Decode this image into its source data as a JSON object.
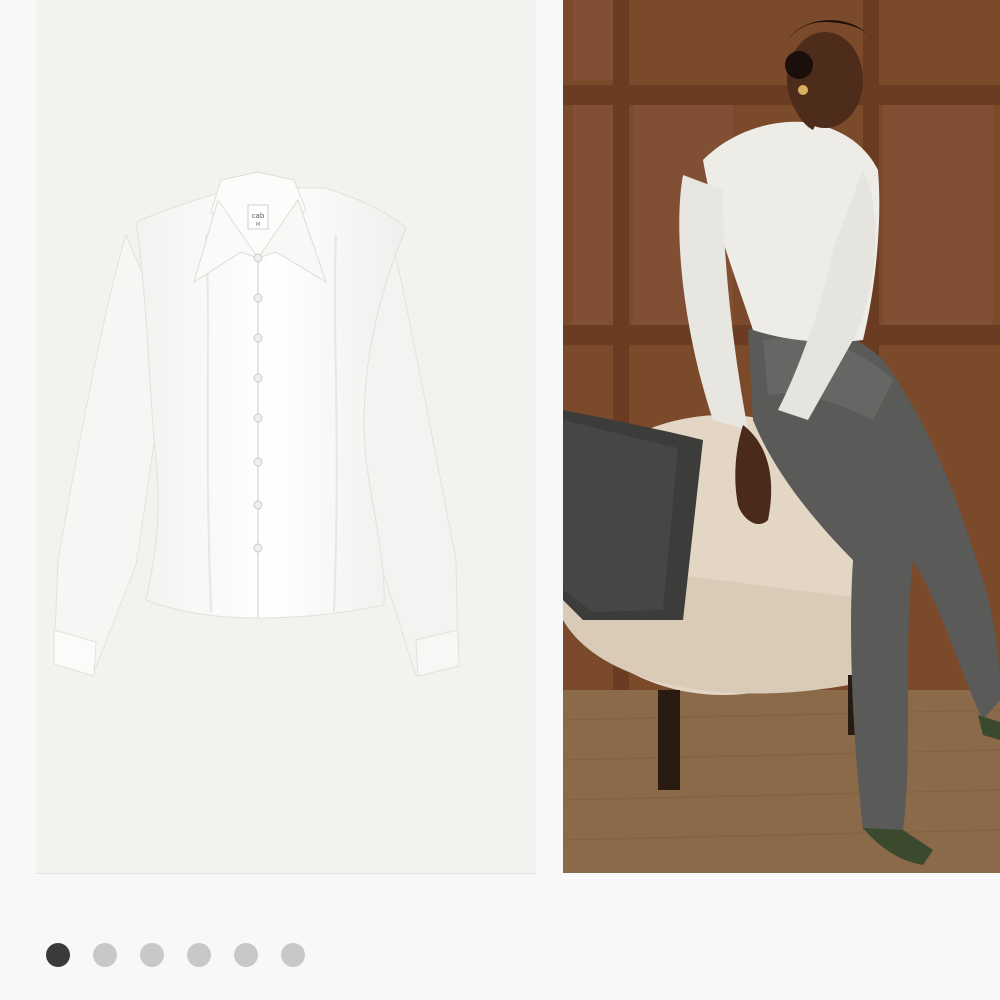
{
  "gallery": {
    "images": [
      {
        "name": "product-image-shirt",
        "label_text": "cab",
        "size_text": "M"
      },
      {
        "name": "model-image"
      }
    ],
    "pagination": {
      "count": 6,
      "active_index": 0,
      "colors": {
        "active": "#3a3a3a",
        "inactive": "#c8c8c8"
      }
    }
  },
  "colors": {
    "left_bg": "#f4f2ee",
    "wood_panel": "#7a4a2c",
    "page_bg": "#f8f8f8"
  }
}
